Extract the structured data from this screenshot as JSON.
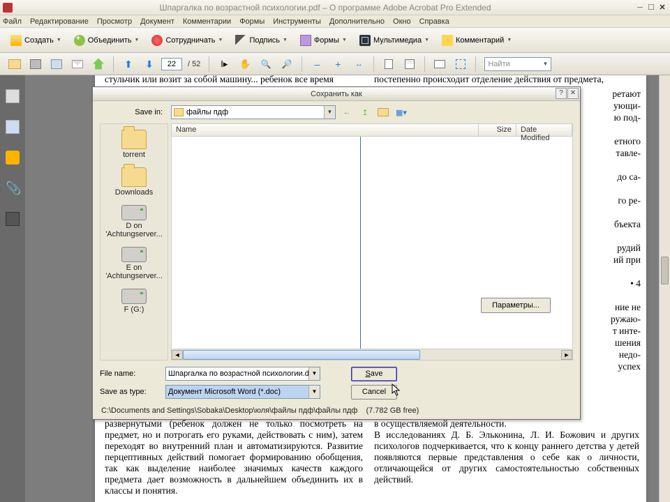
{
  "titlebar": {
    "title": "Шпаргалка по возрастной психологии.pdf – О программе Adobe Acrobat Pro Extended"
  },
  "menu": {
    "file": "Файл",
    "edit": "Редактирование",
    "view": "Просмотр",
    "document": "Документ",
    "comments": "Комментарии",
    "forms": "Формы",
    "tools": "Инструменты",
    "advanced": "Дополнительно",
    "window": "Окно",
    "help": "Справка"
  },
  "tb1": {
    "create": "Создать",
    "combine": "Объединить",
    "collaborate": "Сотрудничать",
    "sign": "Подпись",
    "forms": "Формы",
    "multimedia": "Мультимедиа",
    "comment": "Комментарий"
  },
  "tb2": {
    "page": "22",
    "total": "/ 52",
    "find": "Найти"
  },
  "dialog": {
    "title": "Сохранить как",
    "savein_label": "Save in:",
    "savein_value": "файлы пдф",
    "columns": {
      "name": "Name",
      "size": "Size",
      "date": "Date Modified"
    },
    "places": [
      {
        "kind": "folder",
        "label": "torrent"
      },
      {
        "kind": "folder",
        "label": "Downloads"
      },
      {
        "kind": "drive",
        "label": "D on 'Achtungserver..."
      },
      {
        "kind": "drive",
        "label": "E on 'Achtungserver..."
      },
      {
        "kind": "drive",
        "label": "F (G:)"
      }
    ],
    "params": "Параметры...",
    "filename_label": "File name:",
    "filename_value": "Шпаргалка по возрастной психологии.doc",
    "type_label": "Save as type:",
    "type_value": "Документ Microsoft Word (*.doc)",
    "save": "Save",
    "cancel": "Cancel",
    "path": "C:\\Documents and Settings\\Sobaka\\Desktop\\юля\\файлы пдф\\файлы пдф",
    "free": "(7.782 GB free)"
  },
  "doc": {
    "top1": "стульчик или возит за собой машину... ребенок все время",
    "top2": "постепенно происходит отделение действия от предмета,",
    "right_frag": "ретают\nующи-\nю под-\n\nетного\nтавле-\n\nдо са-\n\nго ре-\n\nбъекта\n\nрудий\nий при\n\n• 4\n\nние не\nружаю-\nт инте-\nшения\nнедо-\nуспех",
    "bot1": "развернутыми (ребенок должен не только посмотреть на предмет, но и потрогать его руками, действовать с ним), затем переходят во внутренний план и автоматизируются. Развитие перцептивных действий помогает формированию обобщения, так как выделение наиболее значимых качеств каждого предмета дает возможность в дальнейшем объединить их в классы и понятия.",
    "bot2": "в осуществляемой деятельности.\n    В исследованиях Д. Б. Эльконина, Л. И. Божович и других психологов подчеркивается, что к концу раннего детства у детей появляются первые представления о себе как о личности, отличающейся от других самостоятельностью собственных действий."
  }
}
